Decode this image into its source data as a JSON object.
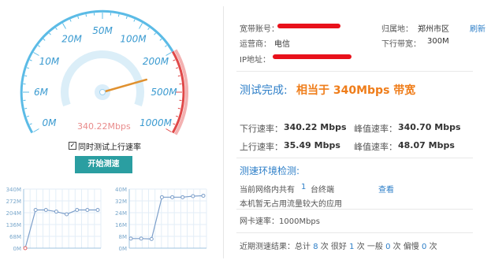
{
  "gauge": {
    "ticks": [
      "0M",
      "6M",
      "10M",
      "20M",
      "50M",
      "100M",
      "200M",
      "500M",
      "1000M"
    ],
    "current": "340.22Mbps",
    "reading_mbps": 340.22
  },
  "options": {
    "upload_checkbox_label": "同时测试上行速率",
    "upload_checked": true,
    "start_button": "开始测速"
  },
  "mini_charts": {
    "left": {
      "y_labels": [
        "340M",
        "272M",
        "204M",
        "136M",
        "68M",
        "0M"
      ],
      "values": [
        0,
        220,
        220,
        210,
        195,
        220,
        220,
        220
      ],
      "y_max": 340
    },
    "right": {
      "y_labels": [
        "40M",
        "32M",
        "24M",
        "16M",
        "8M",
        "0M"
      ],
      "values": [
        6.5,
        6.5,
        6.2,
        34.5,
        34.5,
        34.5,
        35.2,
        35.5
      ],
      "y_max": 40
    }
  },
  "account": {
    "broadband_label": "宽带账号：",
    "location_label": "归属地：",
    "location_value": "郑州市区",
    "refresh": "刷新",
    "isp_label": "运营商：",
    "isp_value": "电信",
    "downlink_label": "下行带宽：",
    "downlink_value": "300M",
    "ip_label": "IP地址："
  },
  "result": {
    "done": "测试完成:",
    "equiv": "相当于 340Mbps 带宽"
  },
  "rates": {
    "down_label": "下行速率：",
    "down_value": "340.22 Mbps",
    "down_peak_label": "峰值速率：",
    "down_peak_value": "340.70 Mbps",
    "up_label": "上行速率：",
    "up_value": "35.49 Mbps",
    "up_peak_label": "峰值速率：",
    "up_peak_value": "48.07 Mbps"
  },
  "env": {
    "title": "测速环境检测:",
    "line1_pre": "当前网络内共有",
    "line1_count": "1",
    "line1_post": "台终端",
    "view": "查看",
    "line2": "本机暂无占用流量较大的应用",
    "nic": "网卡速率：1000Mbps"
  },
  "history": {
    "pre": "近期测速结果：总计",
    "total": "8",
    "unit1": "次  很好",
    "good": "1",
    "unit2": "次  一般",
    "normal": "0",
    "unit3": "次  偏慢",
    "slow": "0",
    "unit4": "次"
  }
}
